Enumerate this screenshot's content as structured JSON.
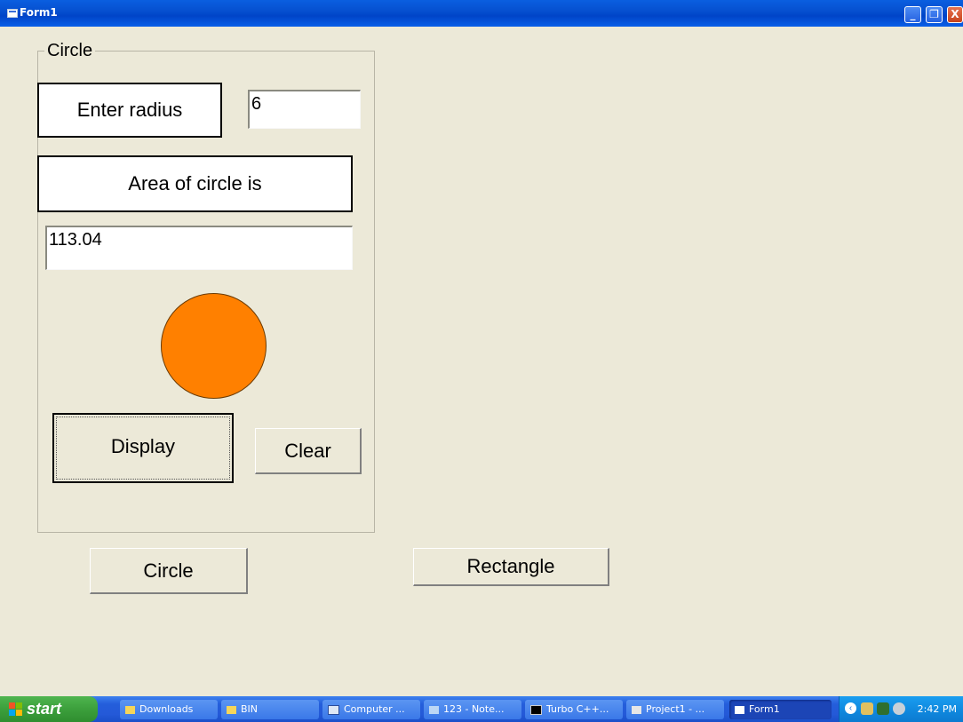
{
  "window": {
    "title": "Form1",
    "minimize_glyph": "_",
    "maximize_glyph": "❐",
    "close_glyph": "X"
  },
  "frame": {
    "caption": "Circle"
  },
  "radius": {
    "label": "Enter radius",
    "value": "6"
  },
  "area": {
    "label": "Area of circle is",
    "value": "113.04"
  },
  "shape": {
    "fill_color": "#FF8000"
  },
  "buttons": {
    "display": "Display",
    "clear": "Clear",
    "circle": "Circle",
    "rectangle": "Rectangle"
  },
  "taskbar": {
    "start_label": "start",
    "items": [
      {
        "label": "Downloads",
        "icon": "folder-icon"
      },
      {
        "label": "BIN",
        "icon": "folder-icon"
      },
      {
        "label": "Computer ...",
        "icon": "document-icon"
      },
      {
        "label": "123 - Note...",
        "icon": "notepad-icon"
      },
      {
        "label": "Turbo C++...",
        "icon": "console-icon"
      },
      {
        "label": "Project1 - ...",
        "icon": "vb-project-icon"
      },
      {
        "label": "Form1",
        "icon": "form-icon"
      }
    ],
    "clock": "2:42 PM"
  }
}
